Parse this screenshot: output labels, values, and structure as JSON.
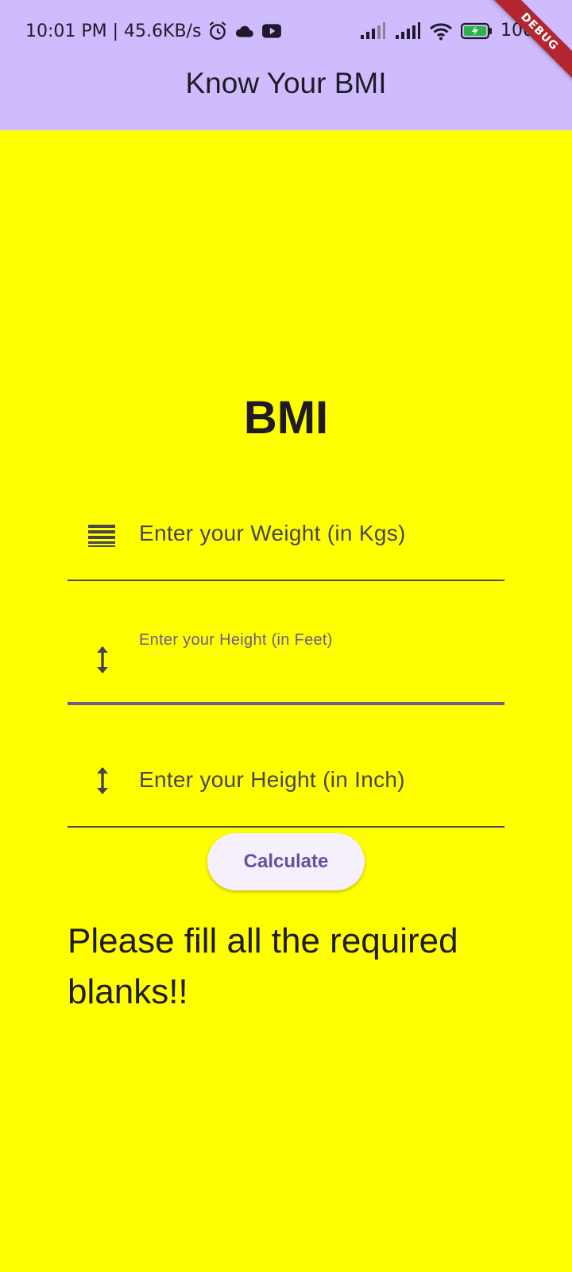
{
  "status_bar": {
    "time_speed": "10:01 PM | 45.6KB/s",
    "battery": "100",
    "icons": [
      "alarm-icon",
      "cloud-icon",
      "youtube-icon",
      "signal-icon",
      "signal-icon",
      "wifi-icon",
      "battery-icon"
    ]
  },
  "debug_banner": "DEBUG",
  "app_bar": {
    "title": "Know Your BMI",
    "background": "#cfbcff"
  },
  "page": {
    "background": "#ffff00",
    "heading": "BMI"
  },
  "form": {
    "weight": {
      "placeholder": "Enter your Weight (in Kgs)",
      "icon": "lines-icon",
      "value": ""
    },
    "height_feet": {
      "label": "Enter your Height (in Feet)",
      "icon": "height-icon",
      "value": "",
      "focused": true
    },
    "height_inch": {
      "placeholder": "Enter your Height (in Inch)",
      "icon": "height-icon",
      "value": ""
    },
    "calculate_label": "Calculate"
  },
  "result_message": "Please fill all the required blanks!!",
  "colors": {
    "accent": "#6750a4",
    "focus_line": "#6d5a91",
    "text": "#1f1a24"
  }
}
